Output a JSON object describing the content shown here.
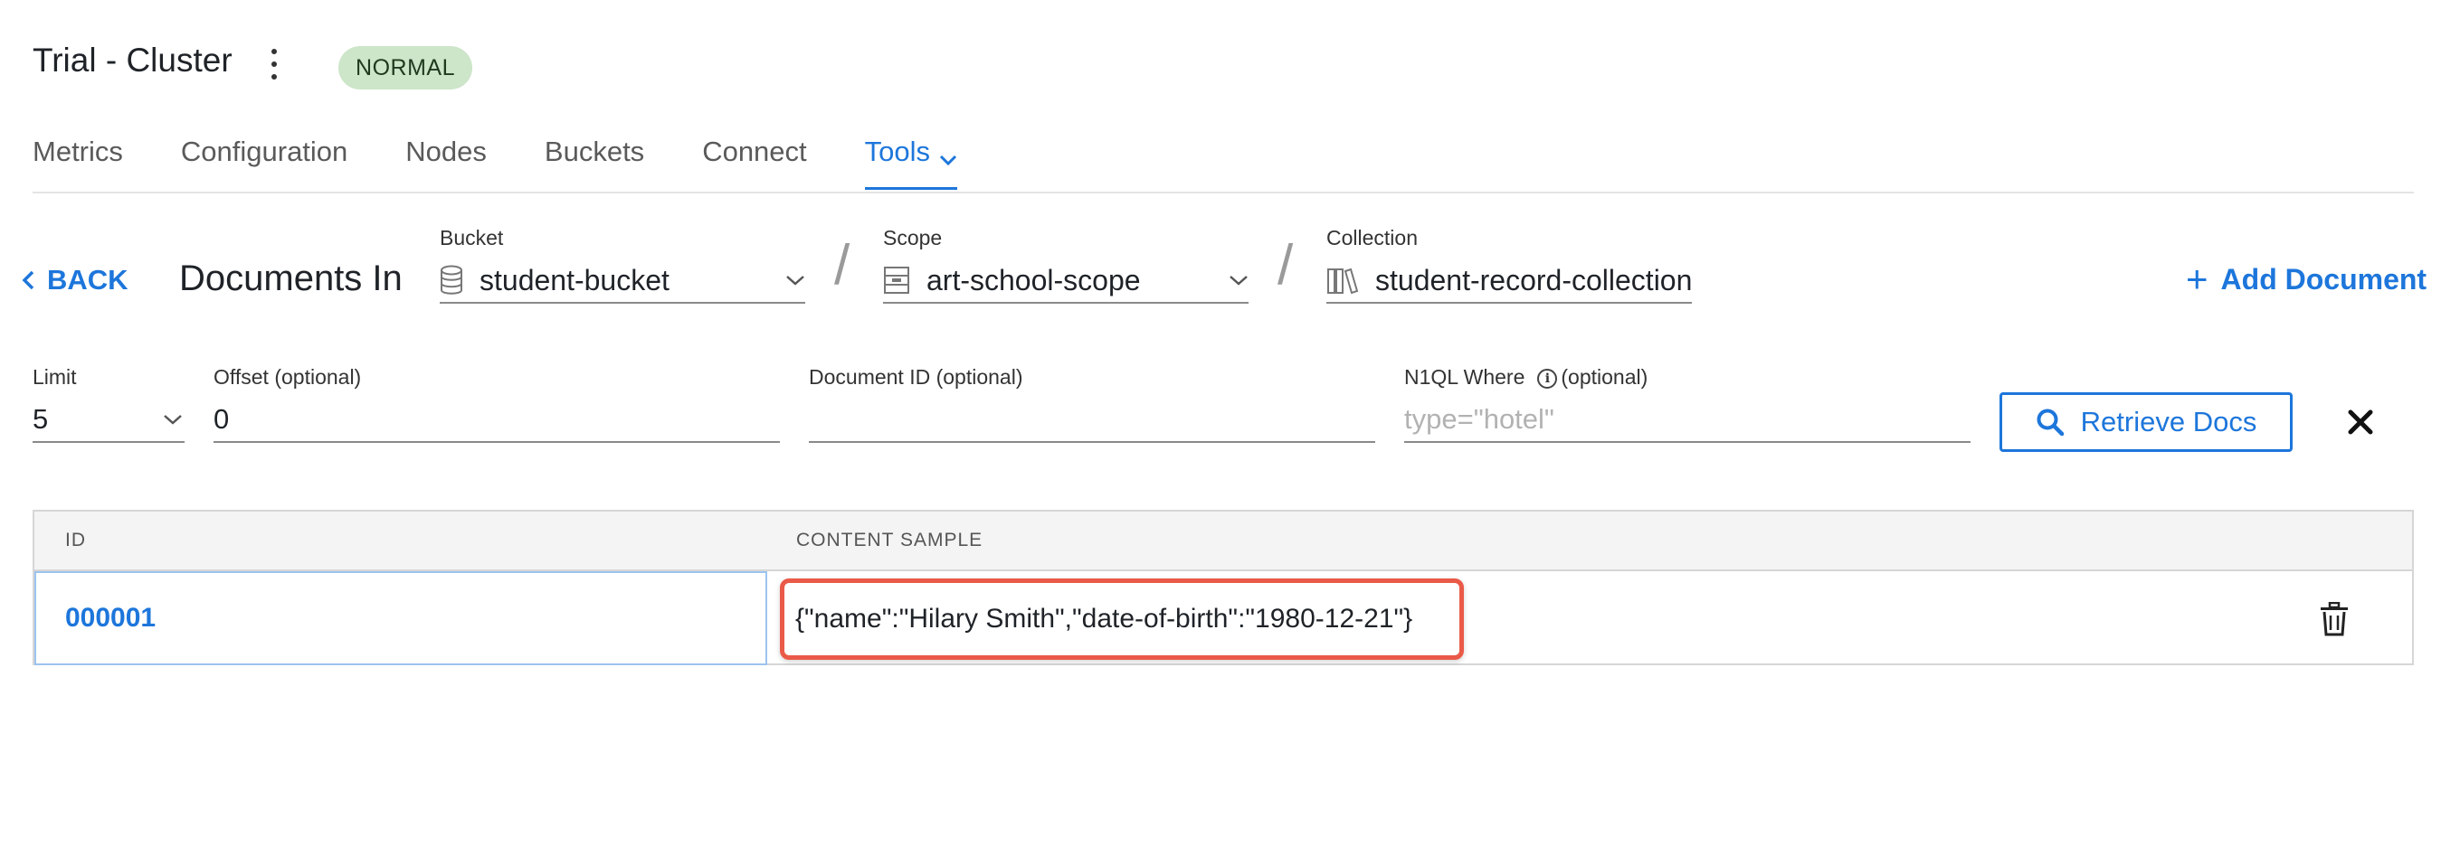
{
  "header": {
    "title": "Trial - Cluster",
    "status": "NORMAL"
  },
  "tabs": [
    {
      "label": "Metrics"
    },
    {
      "label": "Configuration"
    },
    {
      "label": "Nodes"
    },
    {
      "label": "Buckets"
    },
    {
      "label": "Connect"
    },
    {
      "label": "Tools",
      "active": true
    }
  ],
  "docbar": {
    "back_label": "BACK",
    "heading": "Documents In",
    "bucket": {
      "label": "Bucket",
      "value": "student-bucket"
    },
    "scope": {
      "label": "Scope",
      "value": "art-school-scope"
    },
    "collection": {
      "label": "Collection",
      "value": "student-record-collection"
    },
    "add_label": "Add Document"
  },
  "filters": {
    "limit": {
      "label": "Limit",
      "value": "5"
    },
    "offset": {
      "label": "Offset (optional)",
      "value": "0"
    },
    "doc_id": {
      "label": "Document ID (optional)",
      "value": ""
    },
    "n1ql": {
      "label": "N1QL Where",
      "suffix": "(optional)",
      "placeholder": "type=\"hotel\""
    },
    "retrieve_label": "Retrieve Docs"
  },
  "table": {
    "columns": [
      "ID",
      "CONTENT SAMPLE"
    ],
    "rows": [
      {
        "id": "000001",
        "content": "{\"name\":\"Hilary Smith\",\"date-of-birth\":\"1980-12-21\"}"
      }
    ]
  },
  "colors": {
    "accent": "#1d76db",
    "status_bg": "#cde5c9",
    "highlight": "#ea5a48"
  }
}
